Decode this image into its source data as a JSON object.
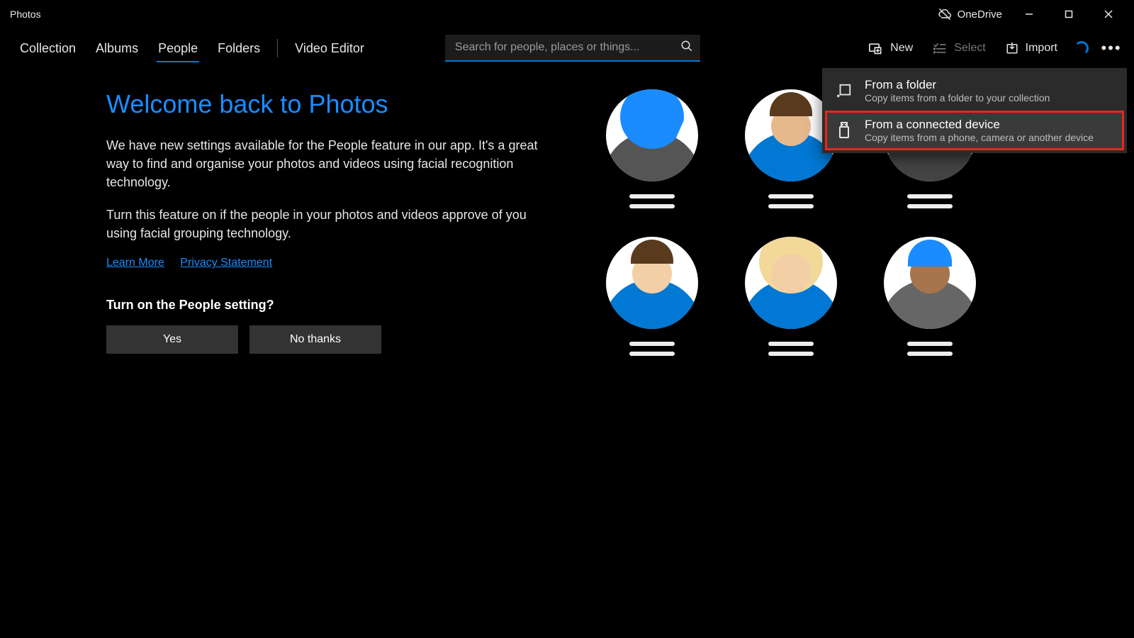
{
  "titlebar": {
    "app_title": "Photos",
    "onedrive_label": "OneDrive"
  },
  "nav": {
    "tabs": [
      "Collection",
      "Albums",
      "People",
      "Folders"
    ],
    "active_index": 2,
    "extra_tab": "Video Editor"
  },
  "search": {
    "placeholder": "Search for people, places or things..."
  },
  "commands": {
    "new": "New",
    "select": "Select",
    "import": "Import"
  },
  "import_menu": {
    "items": [
      {
        "title": "From a folder",
        "subtitle": "Copy items from a folder to your collection",
        "icon": "folder-add"
      },
      {
        "title": "From a connected device",
        "subtitle": "Copy items from a phone, camera or another device",
        "icon": "usb"
      }
    ],
    "highlighted_index": 1
  },
  "welcome": {
    "heading": "Welcome back to Photos",
    "para1": "We have new settings available for the People feature in our app. It's a great way to find and organise your photos and videos using facial recognition technology.",
    "para2": "Turn this feature on if the people in your photos and videos approve of you using facial grouping technology.",
    "link_learn": "Learn More",
    "link_privacy": "Privacy Statement",
    "prompt": "Turn on the People setting?",
    "yes": "Yes",
    "no": "No thanks"
  }
}
